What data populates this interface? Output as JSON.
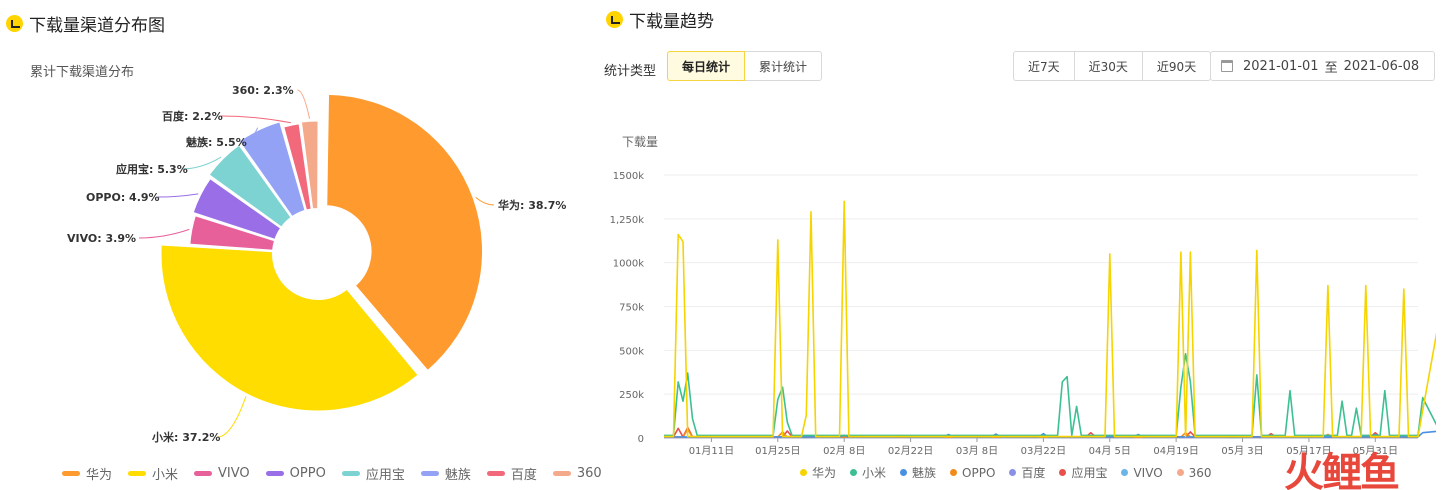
{
  "left_panel": {
    "title": "下载量渠道分布图",
    "subtitle": "累计下载渠道分布"
  },
  "right_panel": {
    "title": "下载量趋势",
    "stat_type_label": "统计类型",
    "stat_buttons": [
      "每日统计",
      "累计统计"
    ],
    "range_buttons": [
      "近7天",
      "近30天",
      "近90天"
    ],
    "date_start": "2021-01-01",
    "date_sep": "至",
    "date_end": "2021-06-08",
    "y_axis_title": "下载量"
  },
  "watermark": "火鲤鱼",
  "colors": {
    "华为": "#ff9a2e",
    "小米": "#ffdd00",
    "VIVO": "#e8609a",
    "OPPO": "#9a6ee6",
    "应用宝": "#7dd3d1",
    "魅族": "#94a2f5",
    "百度": "#f2697c",
    "360": "#f4a98a",
    "line_华为": "#f5d400",
    "line_小米": "#3cc091",
    "line_魅族": "#4a90e2",
    "line_OPPO": "#f28b1c",
    "line_百度": "#8c8fe6",
    "line_应用宝": "#e8504c",
    "line_VIVO": "#6cb4e8",
    "line_360": "#f4a98a"
  },
  "chart_data": [
    {
      "type": "pie",
      "title": "累计下载渠道分布",
      "labels": [
        "华为",
        "小米",
        "VIVO",
        "OPPO",
        "应用宝",
        "魅族",
        "百度",
        "360"
      ],
      "values": [
        38.7,
        37.2,
        3.9,
        4.9,
        5.3,
        5.5,
        2.2,
        2.3
      ],
      "value_labels": [
        "华为: 38.7%",
        "小米: 37.2%",
        "VIVO: 3.9%",
        "OPPO: 4.9%",
        "应用宝: 5.3%",
        "魅族: 5.5%",
        "百度: 2.2%",
        "360: 2.3%"
      ],
      "legend": "bottom",
      "donut": true
    },
    {
      "type": "line",
      "title": "下载量趋势",
      "ylabel": "下载量",
      "ylim": [
        0,
        1500000
      ],
      "yticks": [
        "0",
        "250k",
        "500k",
        "750k",
        "1000k",
        "1,250k",
        "1500k"
      ],
      "xticks": [
        "01月11日",
        "01月25日",
        "02月 8日",
        "02月22日",
        "03月 8日",
        "03月22日",
        "04月 5日",
        "04月19日",
        "05月 3日",
        "05月17日",
        "05月31日"
      ],
      "x_start": "2021-01-01",
      "x_end": "2021-06-08",
      "legend": "bottom",
      "series": [
        {
          "name": "华为",
          "peaks": [
            [
              3,
              1160000
            ],
            [
              4,
              1120000
            ],
            [
              24,
              1130000
            ],
            [
              30,
              130000
            ],
            [
              31,
              1290000
            ],
            [
              38,
              1350000
            ],
            [
              94,
              1050000
            ],
            [
              109,
              1060000
            ],
            [
              111,
              1060000
            ],
            [
              125,
              1070000
            ],
            [
              140,
              870000
            ],
            [
              148,
              870000
            ],
            [
              156,
              850000
            ],
            [
              165,
              910000
            ]
          ]
        },
        {
          "name": "小米",
          "peaks": [
            [
              3,
              320000
            ],
            [
              4,
              210000
            ],
            [
              5,
              370000
            ],
            [
              6,
              110000
            ],
            [
              24,
              220000
            ],
            [
              25,
              290000
            ],
            [
              26,
              90000
            ],
            [
              84,
              320000
            ],
            [
              85,
              350000
            ],
            [
              87,
              180000
            ],
            [
              109,
              290000
            ],
            [
              110,
              480000
            ],
            [
              111,
              320000
            ],
            [
              125,
              360000
            ],
            [
              132,
              270000
            ],
            [
              143,
              210000
            ],
            [
              146,
              170000
            ],
            [
              152,
              270000
            ],
            [
              160,
              230000
            ],
            [
              163,
              70000
            ],
            [
              166,
              90000
            ]
          ]
        },
        {
          "name": "魅族",
          "peaks": [
            [
              38,
              15000
            ],
            [
              60,
              20000
            ],
            [
              70,
              22000
            ],
            [
              80,
              25000
            ],
            [
              100,
              20000
            ],
            [
              150,
              20000
            ],
            [
              160,
              30000
            ],
            [
              166,
              45000
            ]
          ]
        },
        {
          "name": "OPPO",
          "peaks": [
            [
              5,
              50000
            ],
            [
              25,
              35000
            ],
            [
              110,
              30000
            ],
            [
              140,
              20000
            ]
          ]
        },
        {
          "name": "百度",
          "peaks": [
            [
              40,
              12000
            ],
            [
              80,
              15000
            ],
            [
              120,
              12000
            ]
          ]
        },
        {
          "name": "应用宝",
          "peaks": [
            [
              3,
              55000
            ],
            [
              5,
              60000
            ],
            [
              26,
              40000
            ],
            [
              90,
              30000
            ],
            [
              111,
              35000
            ],
            [
              128,
              25000
            ],
            [
              150,
              30000
            ]
          ]
        },
        {
          "name": "VIVO",
          "peaks": [
            [
              50,
              10000
            ],
            [
              100,
              12000
            ],
            [
              155,
              15000
            ]
          ]
        },
        {
          "name": "360",
          "peaks": [
            [
              30,
              8000
            ],
            [
              120,
              9000
            ]
          ]
        }
      ]
    }
  ]
}
